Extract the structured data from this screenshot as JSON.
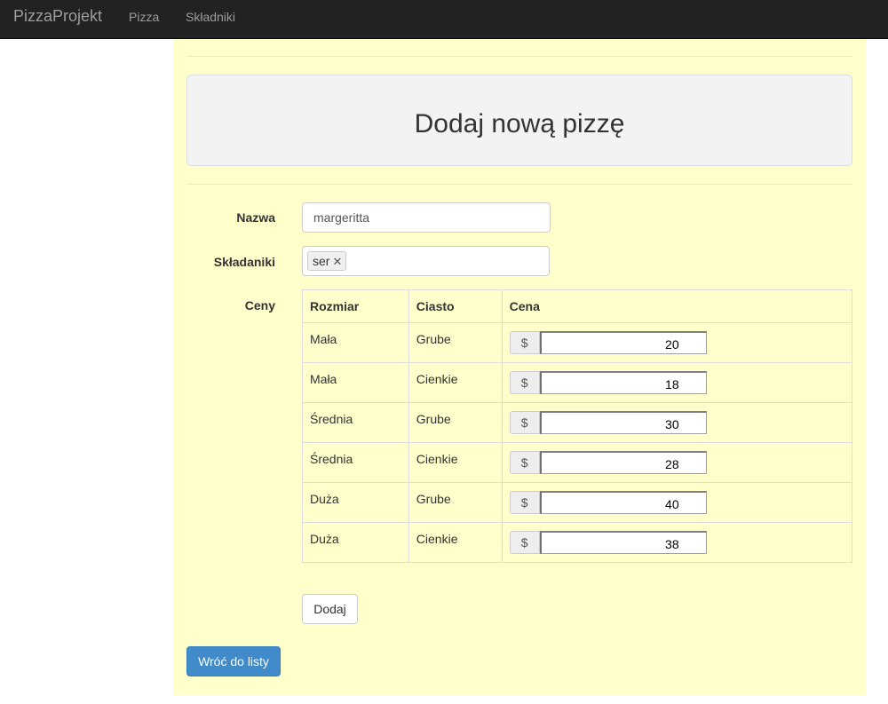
{
  "navbar": {
    "brand": "PizzaProjekt",
    "links": [
      "Pizza",
      "Składniki"
    ]
  },
  "page": {
    "heading": "Dodaj nową pizzę"
  },
  "form": {
    "name_label": "Nazwa",
    "name_value": "margeritta",
    "ingredients_label": "Składaniki",
    "ingredients_tags": [
      "ser"
    ],
    "prices_label": "Ceny"
  },
  "prices_table": {
    "headers": [
      "Rozmiar",
      "Ciasto",
      "Cena"
    ],
    "currency": "$",
    "rows": [
      {
        "size": "Mała",
        "dough": "Grube",
        "price": "20"
      },
      {
        "size": "Mała",
        "dough": "Cienkie",
        "price": "18"
      },
      {
        "size": "Średnia",
        "dough": "Grube",
        "price": "30"
      },
      {
        "size": "Średnia",
        "dough": "Cienkie",
        "price": "28"
      },
      {
        "size": "Duża",
        "dough": "Grube",
        "price": "40"
      },
      {
        "size": "Duża",
        "dough": "Cienkie",
        "price": "38"
      }
    ]
  },
  "buttons": {
    "add": "Dodaj",
    "back": "Wróć do listy"
  },
  "colors": {
    "navbar": "#222222",
    "content_bg": "#ffffcc",
    "primary": "#428bca"
  }
}
